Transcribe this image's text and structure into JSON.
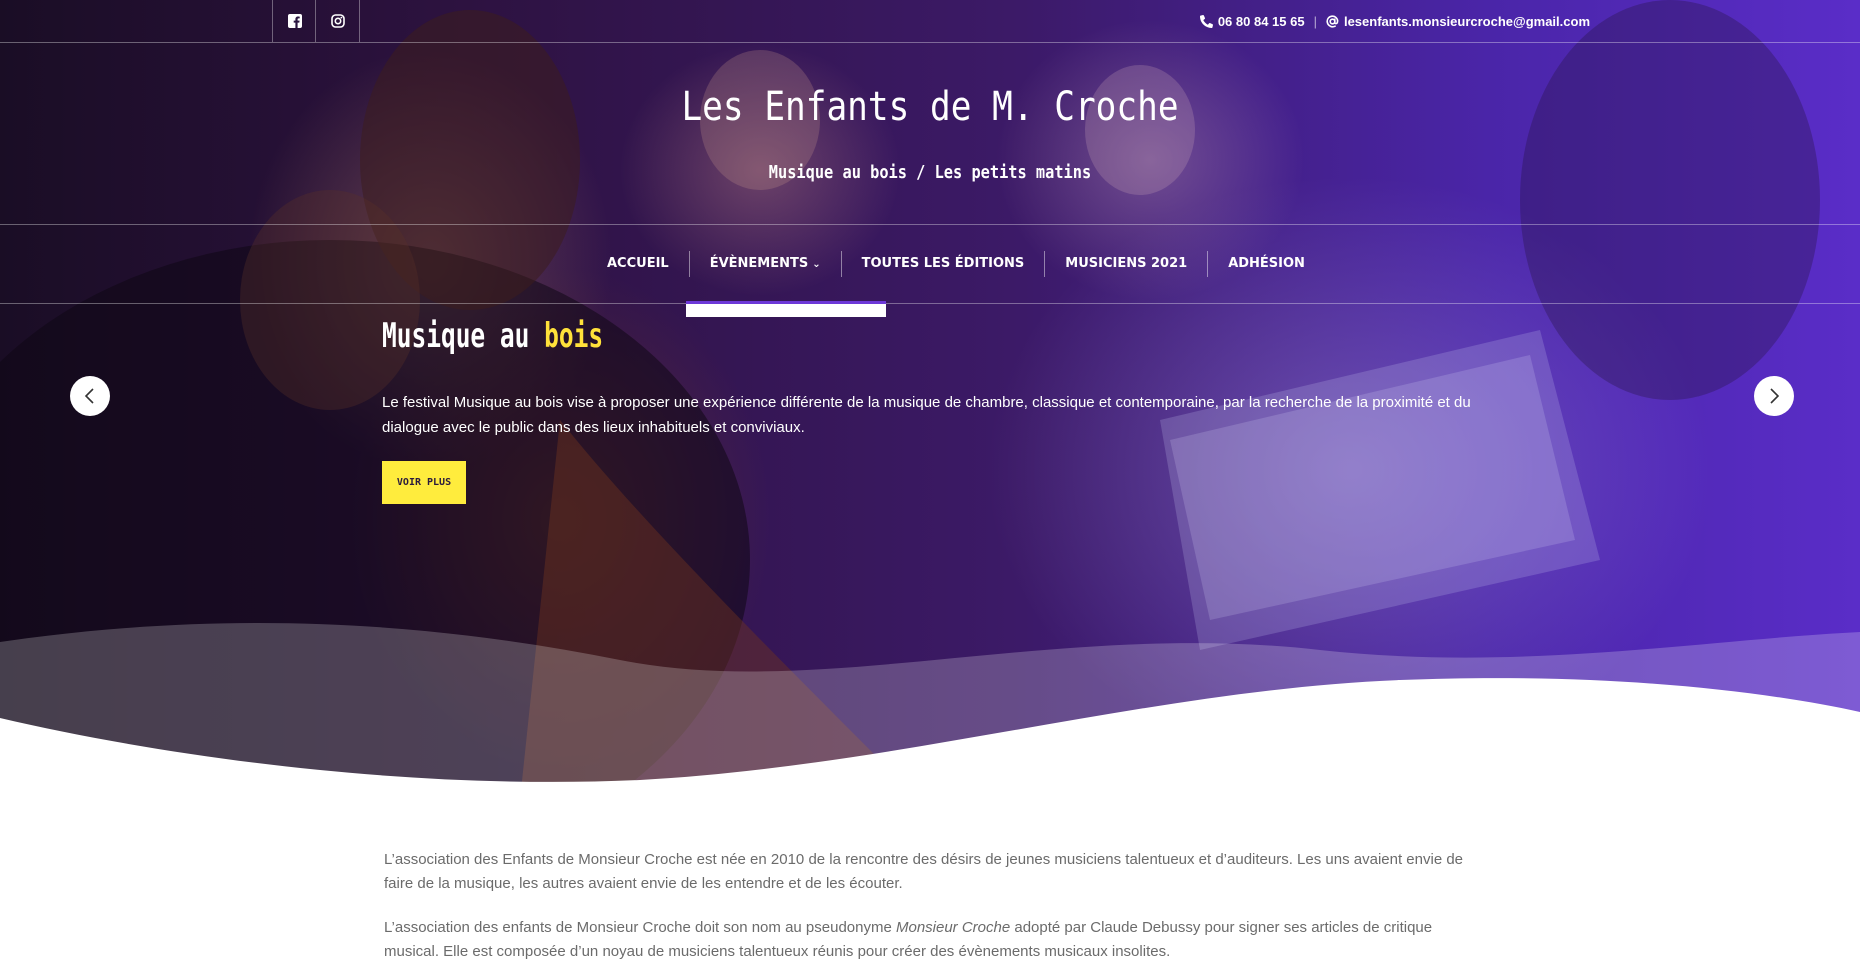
{
  "topbar": {
    "social": [
      {
        "icon": "facebook-icon"
      },
      {
        "icon": "instagram-icon"
      }
    ],
    "phone": "06 80 84 15 65",
    "email": "lesenfants.monsieurcroche@gmail.com"
  },
  "site": {
    "title": "Les Enfants de M. Croche",
    "tagline": "Musique au bois / Les petits matins"
  },
  "nav": {
    "items": [
      {
        "label": "ACCUEIL",
        "active": false
      },
      {
        "label": "ÉVÈNEMENTS",
        "active": true,
        "has_dropdown": true
      },
      {
        "label": "TOUTES LES ÉDITIONS",
        "active": false
      },
      {
        "label": "MUSICIENS 2021",
        "active": false
      },
      {
        "label": "ADHÉSION",
        "active": false
      }
    ]
  },
  "slider": {
    "title_main": "Musique au",
    "title_highlight": "bois",
    "text": "Le festival Musique au bois vise à proposer une expérience différente de la musique de chambre, classique et contemporaine, par la recherche de la proximité et du dialogue avec le public dans des lieux inhabituels et conviviaux.",
    "button_label": "VOIR PLUS"
  },
  "content": {
    "para1": "L’association des Enfants de Monsieur Croche est née en 2010 de la rencontre des désirs de jeunes musiciens talentueux et d’auditeurs. Les uns avaient envie de faire de la musique, les autres avaient envie de les entendre et de les écouter.",
    "para2_before": "L’association des enfants de Monsieur Croche doit son nom au pseudonyme ",
    "para2_em": "Monsieur Croche",
    "para2_after": " adopté par Claude Debussy pour signer ses articles de critique musical. Elle est composée d’un noyau de musiciens talentueux réunis pour créer des évènements musicaux insolites."
  },
  "colors": {
    "accent_yellow": "#ffe13a",
    "button_yellow": "#ffec3d",
    "active_purple": "#6d38d8"
  }
}
